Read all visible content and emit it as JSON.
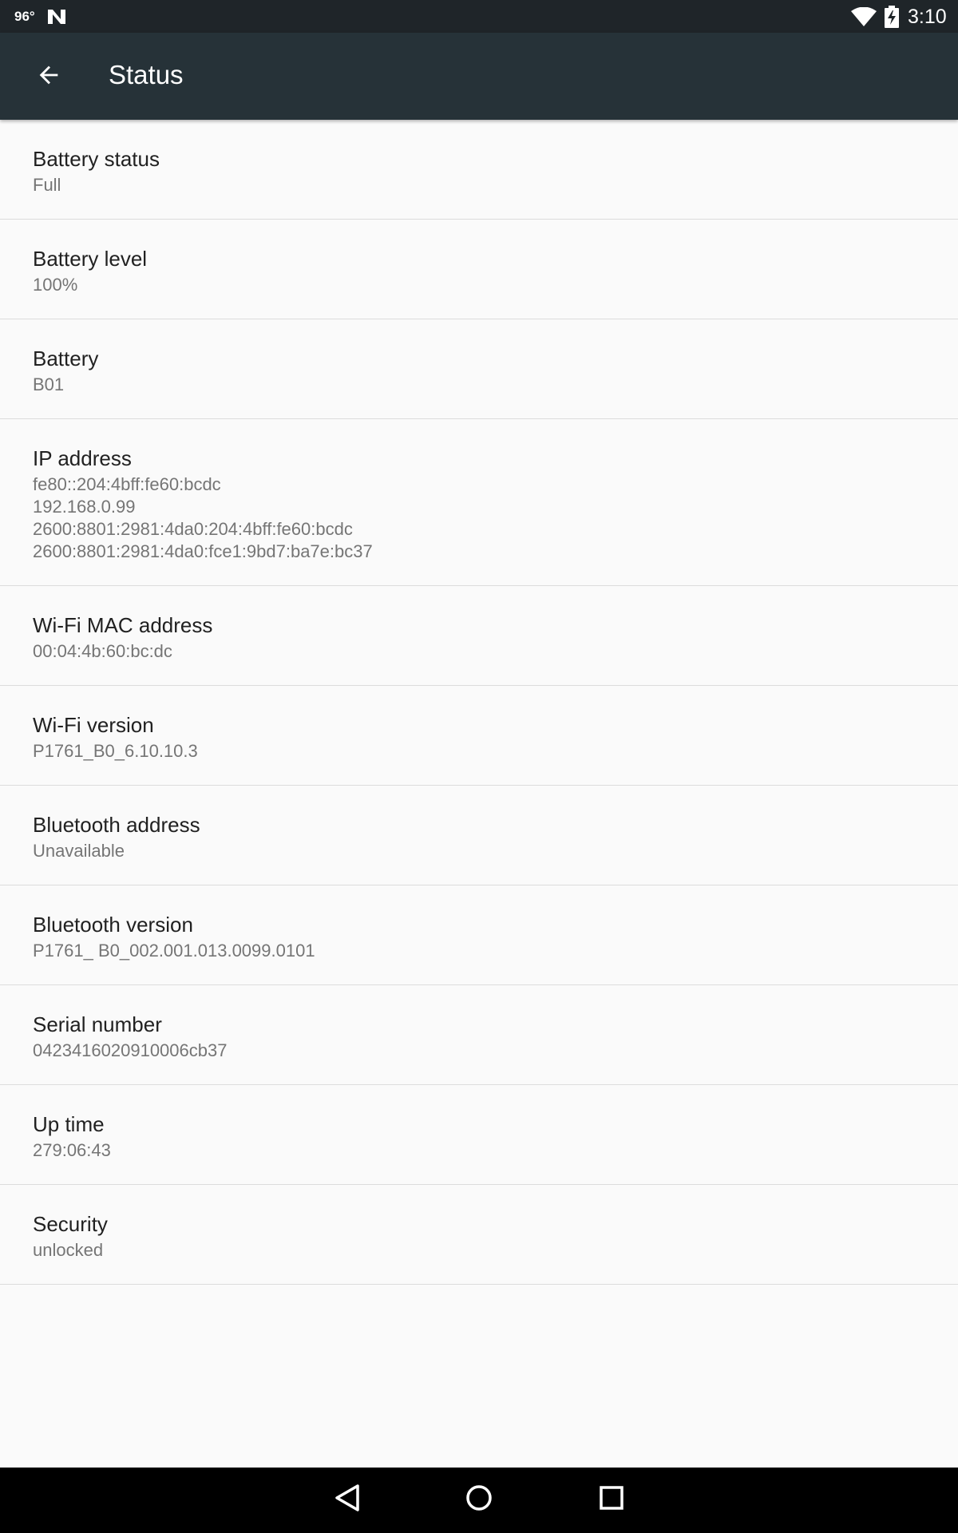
{
  "status_bar": {
    "temperature": "96°",
    "time": "3:10",
    "icons": [
      "n-notification-icon",
      "wifi-icon",
      "battery-charging-icon"
    ]
  },
  "app_bar": {
    "title": "Status",
    "back_icon": "arrow-back-icon"
  },
  "items": [
    {
      "label": "Battery status",
      "value": "Full"
    },
    {
      "label": "Battery level",
      "value": "100%"
    },
    {
      "label": "Battery",
      "value": "B01"
    },
    {
      "label": "IP address",
      "value": "fe80::204:4bff:fe60:bcdc\n192.168.0.99\n2600:8801:2981:4da0:204:4bff:fe60:bcdc\n2600:8801:2981:4da0:fce1:9bd7:ba7e:bc37"
    },
    {
      "label": "Wi-Fi MAC address",
      "value": "00:04:4b:60:bc:dc"
    },
    {
      "label": "Wi-Fi version",
      "value": "P1761_B0_6.10.10.3"
    },
    {
      "label": "Bluetooth address",
      "value": "Unavailable"
    },
    {
      "label": "Bluetooth version",
      "value": "P1761_ B0_002.001.013.0099.0101"
    },
    {
      "label": "Serial number",
      "value": "0423416020910006cb37"
    },
    {
      "label": "Up time",
      "value": "279:06:43"
    },
    {
      "label": "Security",
      "value": "unlocked"
    }
  ],
  "nav_bar": {
    "icons": [
      "back-triangle-icon",
      "home-circle-icon",
      "recents-square-icon"
    ]
  },
  "colors": {
    "status_bar": "#1f2529",
    "app_bar": "#263238",
    "background": "#fafafa",
    "primary_text": "#212121",
    "secondary_text": "#757575"
  }
}
